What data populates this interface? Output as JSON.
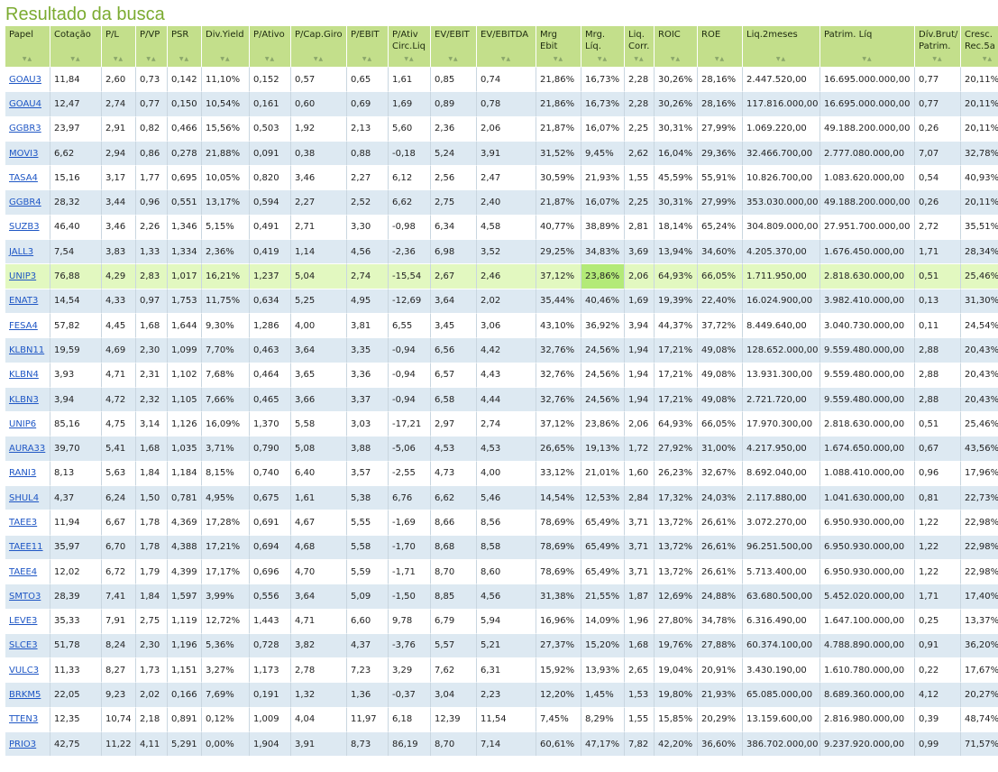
{
  "title": "Resultado da busca",
  "sort_arrows": "▼▲",
  "headers": [
    "Papel",
    "Cotação",
    "P/L",
    "P/VP",
    "PSR",
    "Div.Yield",
    "P/Ativo",
    "P/Cap.Giro",
    "P/EBIT",
    "P/Ativ Circ.Liq",
    "EV/EBIT",
    "EV/EBITDA",
    "Mrg Ebit",
    "Mrg. Líq.",
    "Liq. Corr.",
    "ROIC",
    "ROE",
    "Liq.2meses",
    "Patrim. Líq",
    "Dív.Brut/ Patrim.",
    "Cresc. Rec.5a"
  ],
  "highlight_row": 8,
  "highlight_col": 13,
  "rows": [
    [
      "GOAU3",
      "11,84",
      "2,60",
      "0,73",
      "0,142",
      "11,10%",
      "0,152",
      "0,57",
      "0,65",
      "1,61",
      "0,85",
      "0,74",
      "21,86%",
      "16,73%",
      "2,28",
      "30,26%",
      "28,16%",
      "2.447.520,00",
      "16.695.000.000,00",
      "0,77",
      "20,11%"
    ],
    [
      "GOAU4",
      "12,47",
      "2,74",
      "0,77",
      "0,150",
      "10,54%",
      "0,161",
      "0,60",
      "0,69",
      "1,69",
      "0,89",
      "0,78",
      "21,86%",
      "16,73%",
      "2,28",
      "30,26%",
      "28,16%",
      "117.816.000,00",
      "16.695.000.000,00",
      "0,77",
      "20,11%"
    ],
    [
      "GGBR3",
      "23,97",
      "2,91",
      "0,82",
      "0,466",
      "15,56%",
      "0,503",
      "1,92",
      "2,13",
      "5,60",
      "2,36",
      "2,06",
      "21,87%",
      "16,07%",
      "2,25",
      "30,31%",
      "27,99%",
      "1.069.220,00",
      "49.188.200.000,00",
      "0,26",
      "20,11%"
    ],
    [
      "MOVI3",
      "6,62",
      "2,94",
      "0,86",
      "0,278",
      "21,88%",
      "0,091",
      "0,38",
      "0,88",
      "-0,18",
      "5,24",
      "3,91",
      "31,52%",
      "9,45%",
      "2,62",
      "16,04%",
      "29,36%",
      "32.466.700,00",
      "2.777.080.000,00",
      "7,07",
      "32,78%"
    ],
    [
      "TASA4",
      "15,16",
      "3,17",
      "1,77",
      "0,695",
      "10,05%",
      "0,820",
      "3,46",
      "2,27",
      "6,12",
      "2,56",
      "2,47",
      "30,59%",
      "21,93%",
      "1,55",
      "45,59%",
      "55,91%",
      "10.826.700,00",
      "1.083.620.000,00",
      "0,54",
      "40,93%"
    ],
    [
      "GGBR4",
      "28,32",
      "3,44",
      "0,96",
      "0,551",
      "13,17%",
      "0,594",
      "2,27",
      "2,52",
      "6,62",
      "2,75",
      "2,40",
      "21,87%",
      "16,07%",
      "2,25",
      "30,31%",
      "27,99%",
      "353.030.000,00",
      "49.188.200.000,00",
      "0,26",
      "20,11%"
    ],
    [
      "SUZB3",
      "46,40",
      "3,46",
      "2,26",
      "1,346",
      "5,15%",
      "0,491",
      "2,71",
      "3,30",
      "-0,98",
      "6,34",
      "4,58",
      "40,77%",
      "38,89%",
      "2,81",
      "18,14%",
      "65,24%",
      "304.809.000,00",
      "27.951.700.000,00",
      "2,72",
      "35,51%"
    ],
    [
      "JALL3",
      "7,54",
      "3,83",
      "1,33",
      "1,334",
      "2,36%",
      "0,419",
      "1,14",
      "4,56",
      "-2,36",
      "6,98",
      "3,52",
      "29,25%",
      "34,83%",
      "3,69",
      "13,94%",
      "34,60%",
      "4.205.370,00",
      "1.676.450.000,00",
      "1,71",
      "28,34%"
    ],
    [
      "UNIP3",
      "76,88",
      "4,29",
      "2,83",
      "1,017",
      "16,21%",
      "1,237",
      "5,04",
      "2,74",
      "-15,54",
      "2,67",
      "2,46",
      "37,12%",
      "23,86%",
      "2,06",
      "64,93%",
      "66,05%",
      "1.711.950,00",
      "2.818.630.000,00",
      "0,51",
      "25,46%"
    ],
    [
      "ENAT3",
      "14,54",
      "4,33",
      "0,97",
      "1,753",
      "11,75%",
      "0,634",
      "5,25",
      "4,95",
      "-12,69",
      "3,64",
      "2,02",
      "35,44%",
      "40,46%",
      "1,69",
      "19,39%",
      "22,40%",
      "16.024.900,00",
      "3.982.410.000,00",
      "0,13",
      "31,30%"
    ],
    [
      "FESA4",
      "57,82",
      "4,45",
      "1,68",
      "1,644",
      "9,30%",
      "1,286",
      "4,00",
      "3,81",
      "6,55",
      "3,45",
      "3,06",
      "43,10%",
      "36,92%",
      "3,94",
      "44,37%",
      "37,72%",
      "8.449.640,00",
      "3.040.730.000,00",
      "0,11",
      "24,54%"
    ],
    [
      "KLBN11",
      "19,59",
      "4,69",
      "2,30",
      "1,099",
      "7,70%",
      "0,463",
      "3,64",
      "3,35",
      "-0,94",
      "6,56",
      "4,42",
      "32,76%",
      "24,56%",
      "1,94",
      "17,21%",
      "49,08%",
      "128.652.000,00",
      "9.559.480.000,00",
      "2,88",
      "20,43%"
    ],
    [
      "KLBN4",
      "3,93",
      "4,71",
      "2,31",
      "1,102",
      "7,68%",
      "0,464",
      "3,65",
      "3,36",
      "-0,94",
      "6,57",
      "4,43",
      "32,76%",
      "24,56%",
      "1,94",
      "17,21%",
      "49,08%",
      "13.931.300,00",
      "9.559.480.000,00",
      "2,88",
      "20,43%"
    ],
    [
      "KLBN3",
      "3,94",
      "4,72",
      "2,32",
      "1,105",
      "7,66%",
      "0,465",
      "3,66",
      "3,37",
      "-0,94",
      "6,58",
      "4,44",
      "32,76%",
      "24,56%",
      "1,94",
      "17,21%",
      "49,08%",
      "2.721.720,00",
      "9.559.480.000,00",
      "2,88",
      "20,43%"
    ],
    [
      "UNIP6",
      "85,16",
      "4,75",
      "3,14",
      "1,126",
      "16,09%",
      "1,370",
      "5,58",
      "3,03",
      "-17,21",
      "2,97",
      "2,74",
      "37,12%",
      "23,86%",
      "2,06",
      "64,93%",
      "66,05%",
      "17.970.300,00",
      "2.818.630.000,00",
      "0,51",
      "25,46%"
    ],
    [
      "AURA33",
      "39,70",
      "5,41",
      "1,68",
      "1,035",
      "3,71%",
      "0,790",
      "5,08",
      "3,88",
      "-5,06",
      "4,53",
      "4,53",
      "26,65%",
      "19,13%",
      "1,72",
      "27,92%",
      "31,00%",
      "4.217.950,00",
      "1.674.650.000,00",
      "0,67",
      "43,56%"
    ],
    [
      "RANI3",
      "8,13",
      "5,63",
      "1,84",
      "1,184",
      "8,15%",
      "0,740",
      "6,40",
      "3,57",
      "-2,55",
      "4,73",
      "4,00",
      "33,12%",
      "21,01%",
      "1,60",
      "26,23%",
      "32,67%",
      "8.692.040,00",
      "1.088.410.000,00",
      "0,96",
      "17,96%"
    ],
    [
      "SHUL4",
      "4,37",
      "6,24",
      "1,50",
      "0,781",
      "4,95%",
      "0,675",
      "1,61",
      "5,38",
      "6,76",
      "6,62",
      "5,46",
      "14,54%",
      "12,53%",
      "2,84",
      "17,32%",
      "24,03%",
      "2.117.880,00",
      "1.041.630.000,00",
      "0,81",
      "22,73%"
    ],
    [
      "TAEE3",
      "11,94",
      "6,67",
      "1,78",
      "4,369",
      "17,28%",
      "0,691",
      "4,67",
      "5,55",
      "-1,69",
      "8,66",
      "8,56",
      "78,69%",
      "65,49%",
      "3,71",
      "13,72%",
      "26,61%",
      "3.072.270,00",
      "6.950.930.000,00",
      "1,22",
      "22,98%"
    ],
    [
      "TAEE11",
      "35,97",
      "6,70",
      "1,78",
      "4,388",
      "17,21%",
      "0,694",
      "4,68",
      "5,58",
      "-1,70",
      "8,68",
      "8,58",
      "78,69%",
      "65,49%",
      "3,71",
      "13,72%",
      "26,61%",
      "96.251.500,00",
      "6.950.930.000,00",
      "1,22",
      "22,98%"
    ],
    [
      "TAEE4",
      "12,02",
      "6,72",
      "1,79",
      "4,399",
      "17,17%",
      "0,696",
      "4,70",
      "5,59",
      "-1,71",
      "8,70",
      "8,60",
      "78,69%",
      "65,49%",
      "3,71",
      "13,72%",
      "26,61%",
      "5.713.400,00",
      "6.950.930.000,00",
      "1,22",
      "22,98%"
    ],
    [
      "SMTO3",
      "28,39",
      "7,41",
      "1,84",
      "1,597",
      "3,99%",
      "0,556",
      "3,64",
      "5,09",
      "-1,50",
      "8,85",
      "4,56",
      "31,38%",
      "21,55%",
      "1,87",
      "12,69%",
      "24,88%",
      "63.680.500,00",
      "5.452.020.000,00",
      "1,71",
      "17,40%"
    ],
    [
      "LEVE3",
      "35,33",
      "7,91",
      "2,75",
      "1,119",
      "12,72%",
      "1,443",
      "4,71",
      "6,60",
      "9,78",
      "6,79",
      "5,94",
      "16,96%",
      "14,09%",
      "1,96",
      "27,80%",
      "34,78%",
      "6.316.490,00",
      "1.647.100.000,00",
      "0,25",
      "13,37%"
    ],
    [
      "SLCE3",
      "51,78",
      "8,24",
      "2,30",
      "1,196",
      "5,36%",
      "0,728",
      "3,82",
      "4,37",
      "-3,76",
      "5,57",
      "5,21",
      "27,37%",
      "15,20%",
      "1,68",
      "19,76%",
      "27,88%",
      "60.374.100,00",
      "4.788.890.000,00",
      "0,91",
      "36,20%"
    ],
    [
      "VULC3",
      "11,33",
      "8,27",
      "1,73",
      "1,151",
      "3,27%",
      "1,173",
      "2,78",
      "7,23",
      "3,29",
      "7,62",
      "6,31",
      "15,92%",
      "13,93%",
      "2,65",
      "19,04%",
      "20,91%",
      "3.430.190,00",
      "1.610.780.000,00",
      "0,22",
      "17,67%"
    ],
    [
      "BRKM5",
      "22,05",
      "9,23",
      "2,02",
      "0,166",
      "7,69%",
      "0,191",
      "1,32",
      "1,36",
      "-0,37",
      "3,04",
      "2,23",
      "12,20%",
      "1,45%",
      "1,53",
      "19,80%",
      "21,93%",
      "65.085.000,00",
      "8.689.360.000,00",
      "4,12",
      "20,27%"
    ],
    [
      "TTEN3",
      "12,35",
      "10,74",
      "2,18",
      "0,891",
      "0,12%",
      "1,009",
      "4,04",
      "11,97",
      "6,18",
      "12,39",
      "11,54",
      "7,45%",
      "8,29%",
      "1,55",
      "15,85%",
      "20,29%",
      "13.159.600,00",
      "2.816.980.000,00",
      "0,39",
      "48,74%"
    ],
    [
      "PRIO3",
      "42,75",
      "11,22",
      "4,11",
      "5,291",
      "0,00%",
      "1,904",
      "3,91",
      "8,73",
      "86,19",
      "8,70",
      "7,14",
      "60,61%",
      "47,17%",
      "7,82",
      "42,20%",
      "36,60%",
      "386.702.000,00",
      "9.237.920.000,00",
      "0,99",
      "71,57%"
    ]
  ]
}
